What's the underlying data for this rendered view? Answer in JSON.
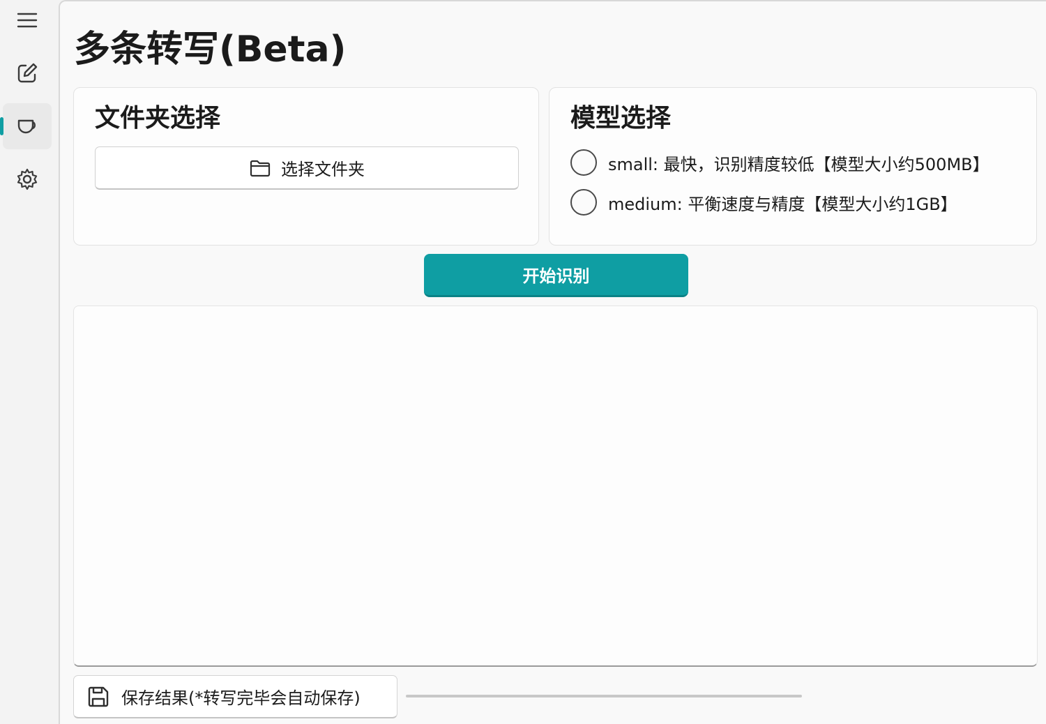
{
  "app": {
    "page_title": "多条转写(Beta)"
  },
  "sidebar": {
    "items": [
      {
        "icon": "hamburger-menu-icon"
      },
      {
        "icon": "edit-icon"
      },
      {
        "icon": "shield-icon",
        "selected": true
      },
      {
        "icon": "gear-icon"
      }
    ]
  },
  "folder_card": {
    "title": "文件夹选择",
    "button_label": "选择文件夹",
    "button_icon": "folder-icon"
  },
  "model_card": {
    "title": "模型选择",
    "options": [
      {
        "label": "small: 最快，识别精度较低【模型大小约500MB】",
        "selected": false
      },
      {
        "label": "medium: 平衡速度与精度【模型大小约1GB】",
        "selected": false
      }
    ]
  },
  "actions": {
    "start_label": "开始识别",
    "save_label": "保存结果(*转写完毕会自动保存)",
    "save_icon": "save-icon"
  },
  "output": {
    "text": ""
  },
  "progress": {
    "value": 0
  },
  "colors": {
    "accent": "#0f9ea3",
    "background": "#f9f9f9",
    "card": "#fdfdfd"
  }
}
